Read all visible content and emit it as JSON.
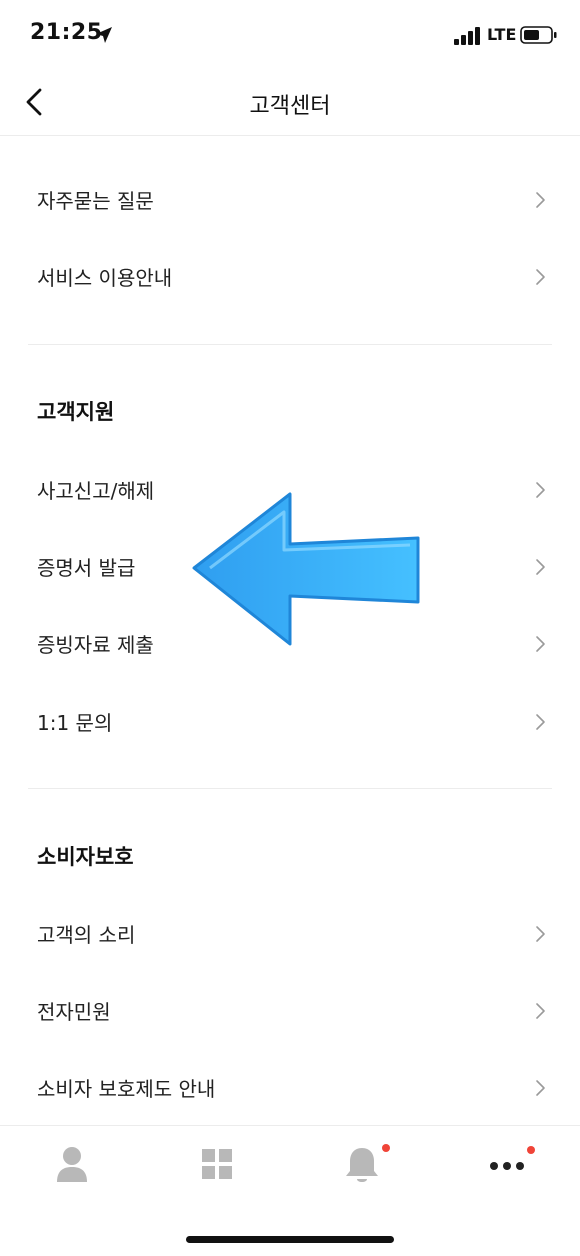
{
  "status_bar": {
    "time": "21:25",
    "network": "LTE",
    "icons": [
      "location-arrow-icon",
      "signal-icon",
      "battery-icon"
    ]
  },
  "nav": {
    "title": "고객센터",
    "back_icon": "chevron-left-icon"
  },
  "group1": {
    "items": [
      {
        "label": "자주묻는 질문"
      },
      {
        "label": "서비스 이용안내"
      }
    ]
  },
  "support": {
    "header": "고객지원",
    "items": [
      {
        "label": "사고신고/해제"
      },
      {
        "label": "증명서 발급"
      },
      {
        "label": "증빙자료 제출"
      },
      {
        "label": "1:1 문의"
      }
    ]
  },
  "consumer": {
    "header": "소비자보호",
    "items": [
      {
        "label": "고객의 소리"
      },
      {
        "label": "전자민원"
      },
      {
        "label": "소비자 보호제도 안내"
      }
    ]
  },
  "tabs": [
    {
      "icon": "person-icon",
      "badge": false
    },
    {
      "icon": "grid-icon",
      "badge": false
    },
    {
      "icon": "bell-icon",
      "badge": true
    },
    {
      "icon": "more-icon",
      "badge": true
    }
  ],
  "colors": {
    "badge": "#f04438",
    "arrow": "#3aaef5",
    "chevron": "#9a9a9a",
    "tab_icon": "#b8b8b8"
  }
}
